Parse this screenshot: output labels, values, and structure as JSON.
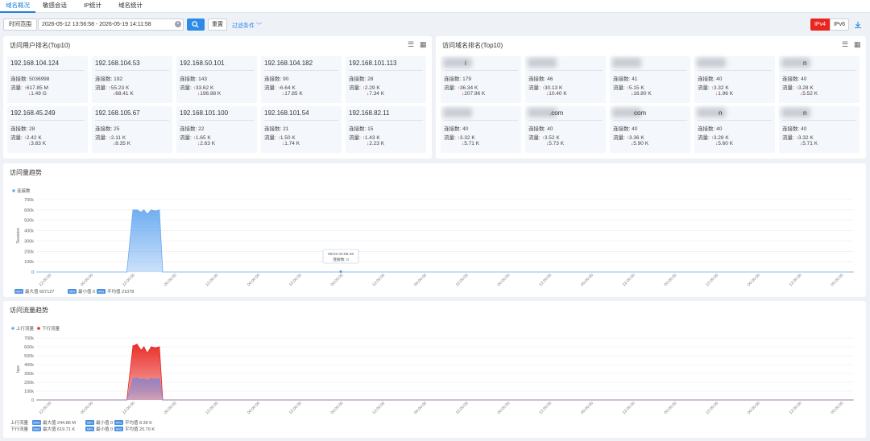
{
  "tabs": [
    "域名概况",
    "敏感会话",
    "IP统计",
    "域名统计"
  ],
  "toolbar": {
    "time_range_label": "时间范围",
    "time_range_value": "2026-05-12 13:56:58 - 2026-05-19 14:11:58",
    "reset_label": "重置",
    "filter_label": "过滤条件",
    "ipv4_label": "IPv4",
    "ipv6_label": "IPv6"
  },
  "user_ranking": {
    "title": "访问用户排名(Top10)",
    "cards": [
      {
        "ip": "192.168.104.124",
        "conn": "连接数: 5036998",
        "up": "617.85 M",
        "down": "1.49 G"
      },
      {
        "ip": "192.168.104.53",
        "conn": "连接数: 192",
        "up": "55.23 K",
        "down": "68.41 K"
      },
      {
        "ip": "192.168.50.101",
        "conn": "连接数: 143",
        "up": "33.62 K",
        "down": "196.98 K"
      },
      {
        "ip": "192.168.104.182",
        "conn": "连接数: 90",
        "up": "6.64 K",
        "down": "17.85 K"
      },
      {
        "ip": "192.168.101.113",
        "conn": "连接数: 28",
        "up": "2.29 K",
        "down": "7.34 K"
      },
      {
        "ip": "192.168.45.249",
        "conn": "连接数: 28",
        "up": "2.42 K",
        "down": "3.83 K"
      },
      {
        "ip": "192.168.105.67",
        "conn": "连接数: 25",
        "up": "2.11 K",
        "down": "8.35 K"
      },
      {
        "ip": "192.168.101.100",
        "conn": "连接数: 22",
        "up": "1.65 K",
        "down": "2.63 K"
      },
      {
        "ip": "192.168.101.54",
        "conn": "连接数: 21",
        "up": "1.50 K",
        "down": "1.74 K"
      },
      {
        "ip": "192.168.82.11",
        "conn": "连接数: 15",
        "up": "1.43 K",
        "down": "2.23 K"
      }
    ],
    "traffic_label": "流量:"
  },
  "domain_ranking": {
    "title": "访问域名排名(Top10)",
    "cards": [
      {
        "domain": "i",
        "conn": "连接数: 179",
        "up": "36.34 K",
        "down": "207.96 K"
      },
      {
        "domain": "",
        "conn": "连接数: 46",
        "up": "30.13 K",
        "down": "10.40 K"
      },
      {
        "domain": "",
        "conn": "连接数: 41",
        "up": "5.15 K",
        "down": "16.80 K"
      },
      {
        "domain": "",
        "conn": "连接数: 40",
        "up": "3.32 K",
        "down": "1.96 K"
      },
      {
        "domain": "n",
        "conn": "连接数: 40",
        "up": "3.28 K",
        "down": "5.52 K"
      },
      {
        "domain": "",
        "conn": "连接数: 40",
        "up": "3.32 K",
        "down": "5.71 K"
      },
      {
        "domain": ".com",
        "conn": "连接数: 40",
        "up": "3.52 K",
        "down": "5.73 K"
      },
      {
        "domain": "com",
        "conn": "连接数: 40",
        "up": "3.36 K",
        "down": "5.90 K"
      },
      {
        "domain": "n",
        "conn": "连接数: 40",
        "up": "3.28 K",
        "down": "5.60 K"
      },
      {
        "domain": "n",
        "conn": "连接数: 40",
        "up": "3.32 K",
        "down": "5.71 K"
      }
    ]
  },
  "colors": {
    "accent": "#2b8be6",
    "ipv4_active": "#e8251f",
    "up_series": "#6aaaf0",
    "down_series": "#e8251f"
  },
  "conn_trend": {
    "title": "访问量趋势",
    "legend": "连接数",
    "ylabel": "Session",
    "tooltip_time": "05/15 02:56:46",
    "tooltip_value": "连接数: 0",
    "stats": [
      {
        "badge": "MAX",
        "text": "最大值 607127"
      },
      {
        "badge": "MIN",
        "text": "最小值 0"
      },
      {
        "badge": "AVG",
        "text": "平均值 21078"
      }
    ]
  },
  "flow_trend": {
    "title": "访问流量趋势",
    "legend_up": "上行流量",
    "legend_down": "下行流量",
    "ylabel": "bps",
    "stats_up_label": "上行流量",
    "stats_down_label": "下行流量",
    "stats_up": [
      {
        "badge": "MAX",
        "text": "最大值 244.86 M"
      },
      {
        "badge": "MIN",
        "text": "最小值 0"
      },
      {
        "badge": "AVG",
        "text": "平均值 8.39 K"
      }
    ],
    "stats_down": [
      {
        "badge": "MAX",
        "text": "最大值 619.71 K"
      },
      {
        "badge": "MIN",
        "text": "最小值 0"
      },
      {
        "badge": "AVG",
        "text": "平均值 20.79 K"
      }
    ]
  },
  "chart_data": [
    {
      "type": "area",
      "title": "访问量趋势",
      "ylabel": "Session",
      "ylim": [
        0,
        700000
      ],
      "yticks": [
        "0",
        "100k",
        "200k",
        "300k",
        "400k",
        "500k",
        "600k",
        "700k"
      ],
      "xticks": [
        "12:00:00",
        "00:00:00",
        "12:00:00",
        "00:00:00",
        "12:00:00",
        "00:00:00",
        "12:00:00",
        "00:00:00",
        "12:00:00",
        "00:00:00",
        "12:00:00",
        "00:00:00",
        "12:00:00",
        "00:00:00",
        "12:00:00",
        "00:00:00",
        "12:00:00",
        "00:00:00",
        "12:00:00",
        "00:00:00"
      ],
      "series": [
        {
          "name": "连接数",
          "x": [
            0,
            2.2,
            2.35,
            2.45,
            2.55,
            2.62,
            2.7,
            2.8,
            2.9,
            3.0,
            3.08,
            3.2,
            20
          ],
          "values": [
            0,
            0,
            600000,
            600000,
            580000,
            600000,
            560000,
            600000,
            590000,
            600000,
            0,
            0,
            0
          ]
        }
      ]
    },
    {
      "type": "area",
      "title": "访问流量趋势",
      "ylabel": "bps",
      "ylim": [
        0,
        700000
      ],
      "yticks": [
        "0",
        "100k",
        "200k",
        "300k",
        "400k",
        "500k",
        "600k",
        "700k"
      ],
      "xticks": [
        "12:00:00",
        "00:00:00",
        "12:00:00",
        "00:00:00",
        "12:00:00",
        "00:00:00",
        "12:00:00",
        "00:00:00",
        "12:00:00",
        "00:00:00",
        "12:00:00",
        "00:00:00",
        "12:00:00",
        "00:00:00",
        "12:00:00",
        "00:00:00",
        "12:00:00",
        "00:00:00",
        "12:00:00",
        "00:00:00"
      ],
      "series": [
        {
          "name": "上行流量",
          "x": [
            0,
            2.2,
            2.35,
            2.45,
            2.55,
            2.62,
            2.7,
            2.8,
            2.9,
            3.0,
            3.08,
            3.2,
            20
          ],
          "values": [
            0,
            0,
            240000,
            250000,
            230000,
            240000,
            220000,
            245000,
            235000,
            240000,
            0,
            0,
            0
          ]
        },
        {
          "name": "下行流量",
          "x": [
            0,
            2.2,
            2.35,
            2.45,
            2.55,
            2.62,
            2.7,
            2.8,
            2.9,
            3.0,
            3.08,
            3.2,
            20
          ],
          "values": [
            0,
            0,
            610000,
            630000,
            560000,
            600000,
            530000,
            600000,
            590000,
            600000,
            0,
            0,
            0
          ]
        }
      ]
    }
  ]
}
